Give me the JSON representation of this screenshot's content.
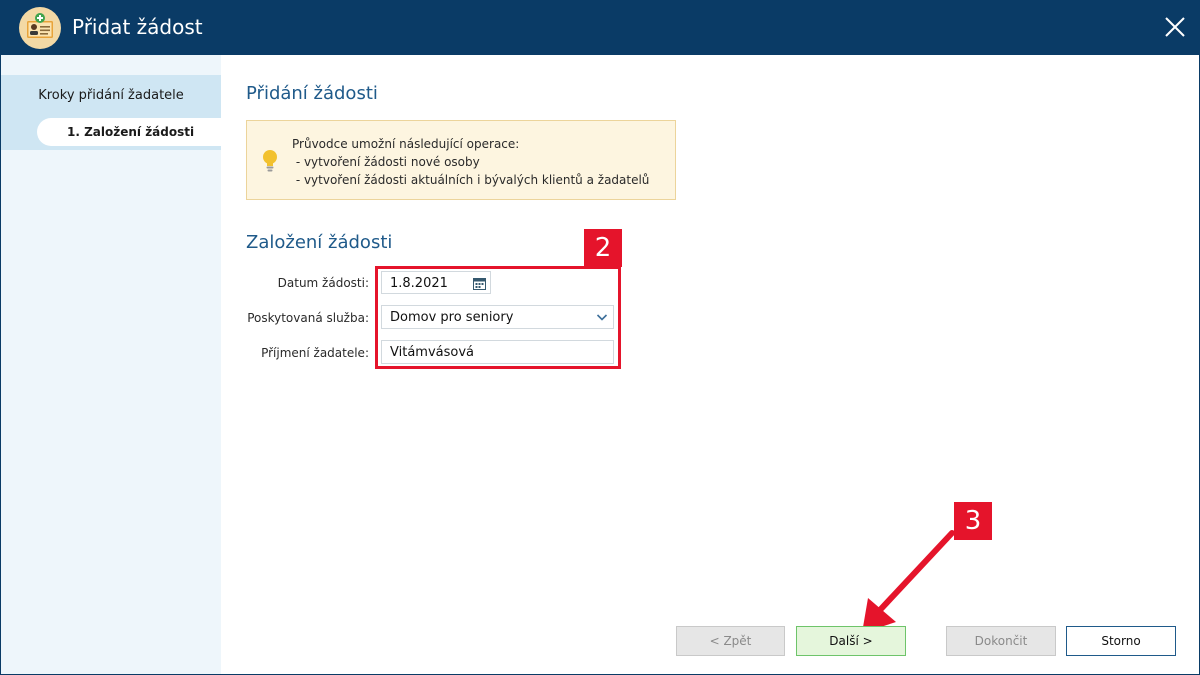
{
  "window": {
    "title": "Přidat žádost",
    "icon": "app-certificate-icon",
    "close_icon": "close-icon"
  },
  "sidebar": {
    "title": "Kroky přidání žadatele",
    "steps": [
      {
        "label": "1. Založení žádosti",
        "active": true
      }
    ]
  },
  "main": {
    "heading": "Přidání žádosti",
    "info": {
      "icon": "lightbulb-icon",
      "lines": [
        "Průvodce umožní následující operace:",
        " - vytvoření žádosti nové osoby",
        " - vytvoření žádosti aktuálních i bývalých klientů a žadatelů"
      ]
    },
    "section_heading": "Založení žádosti",
    "form": {
      "date": {
        "label": "Datum žádosti:",
        "value": "1.8.2021",
        "icon": "calendar-icon"
      },
      "service": {
        "label": "Poskytovaná služba:",
        "value": "Domov pro seniory",
        "icon": "chevron-down-icon"
      },
      "surname": {
        "label": "Příjmení žadatele:",
        "value": "Vitámvásová"
      }
    }
  },
  "annotations": {
    "box_label": "2",
    "arrow_label": "3",
    "color": "#e5142b"
  },
  "buttons": {
    "back": "< Zpět",
    "next": "Další >",
    "finish": "Dokončit",
    "cancel": "Storno"
  },
  "colors": {
    "titlebar": "#0a3b66",
    "heading": "#1f5a8a",
    "sidebar_bg": "#eef6fb",
    "sidebar_active_band": "#cfe6f3",
    "info_bg": "#fdf5e0",
    "next_button": "#e5f6dc"
  }
}
